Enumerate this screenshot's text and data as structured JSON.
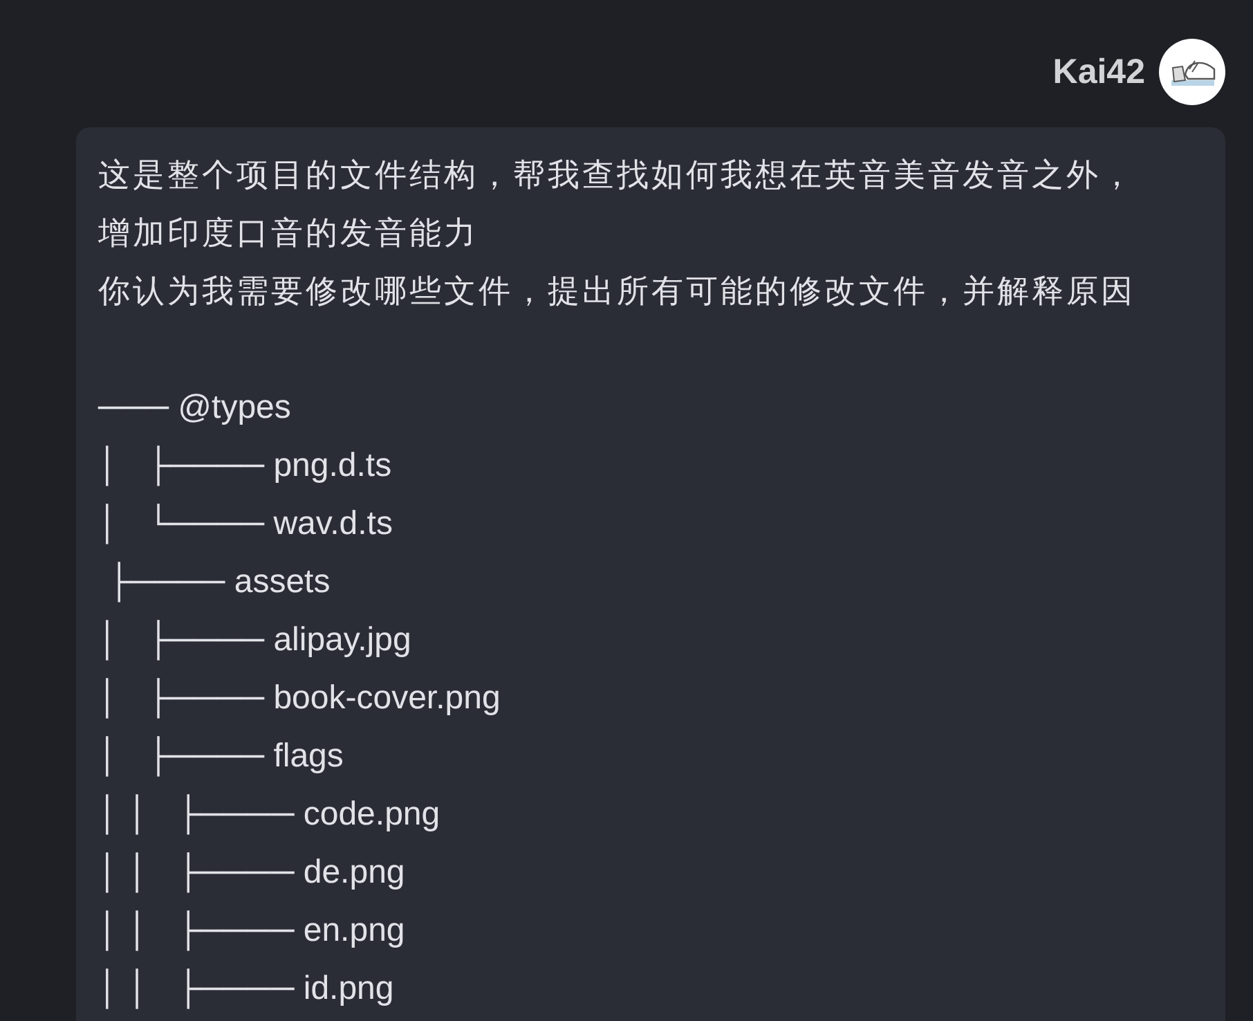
{
  "user": {
    "name": "Kai42"
  },
  "message": {
    "paragraphs": [
      "这是整个项目的文件结构，帮我查找如何我想在英音美音发音之外，",
      "增加印度口音的发音能力",
      "你认为我需要修改哪些文件，提出所有可能的修改文件，并解释原因"
    ],
    "tree_lines": [
      "─── @types",
      "│   ├──── png.d.ts",
      "│   └──── wav.d.ts",
      " ├──── assets",
      "│   ├──── alipay.jpg",
      "│   ├──── book-cover.png",
      "│   ├──── flags",
      "│ │   ├──── code.png",
      "│ │   ├──── de.png",
      "│ │   ├──── en.png",
      "│ │   ├──── id.png"
    ]
  }
}
